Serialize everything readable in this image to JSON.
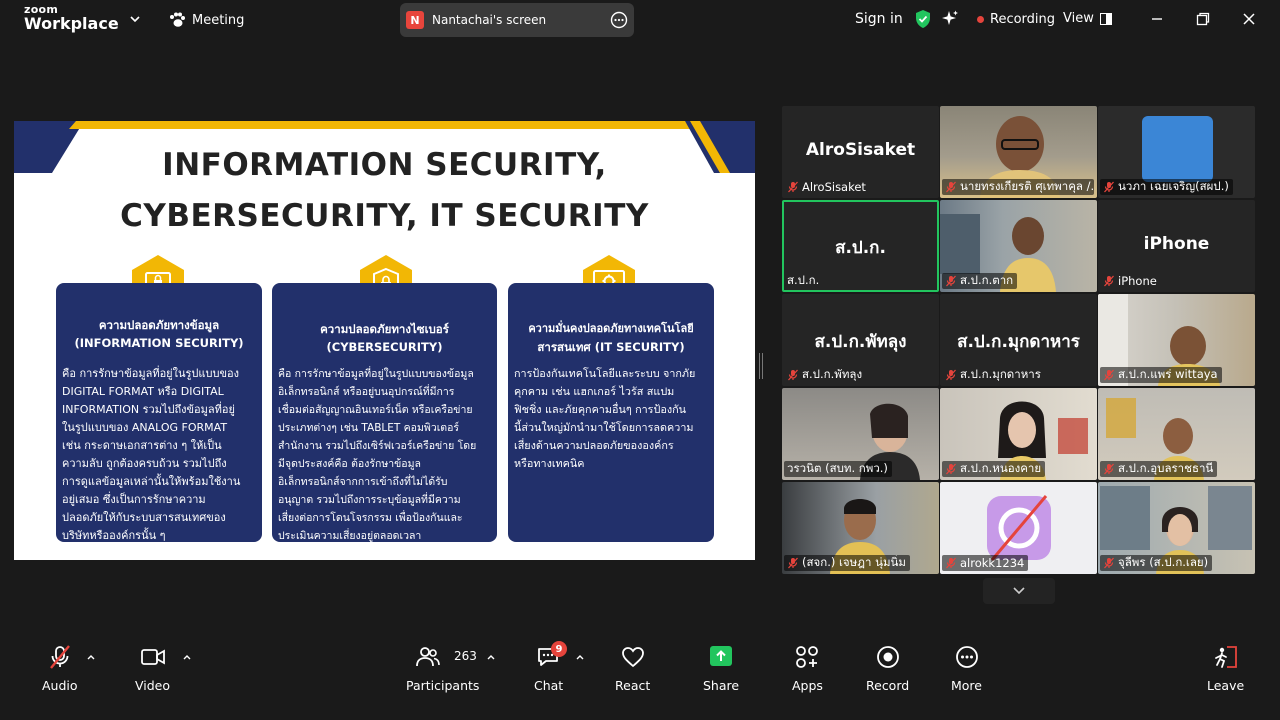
{
  "app": {
    "brand_small": "zoom",
    "brand_big": "Workplace"
  },
  "topbar": {
    "meeting_label": "Meeting",
    "share_badge": "N",
    "share_label": "Nantachai's screen",
    "signin_label": "Sign in",
    "recording_label": "Recording",
    "view_label": "View"
  },
  "slide": {
    "title_line1": "INFORMATION SECURITY,",
    "title_line2": "CYBERSECURITY, IT SECURITY",
    "cards": [
      {
        "title1": "ความปลอดภัยทางข้อมูล",
        "title2": "(INFORMATION SECURITY)",
        "lines": [
          "คือ การรักษาข้อมูลที่อยู่ในรูปแบบของ",
          "DIGITAL FORMAT หรือ DIGITAL",
          "INFORMATION รวมไปถึงข้อมูลที่อยู่",
          "ในรูปแบบของ ANALOG FORMAT",
          "เช่น กระดาษเอกสารต่าง ๆ ให้เป็น",
          "ความลับ ถูกต้องครบถ้วน  รวมไปถึง",
          "การดูแลข้อมูลเหล่านั้นให้พร้อมใช้งาน",
          "อยู่เสมอ ซึ่งเป็นการรักษาความ",
          "ปลอดภัยให้กับระบบสารสนเทศของ",
          "บริษัทหรือองค์กรนั้น ๆ"
        ]
      },
      {
        "title1": "ความปลอดภัยทางไซเบอร์",
        "title2": "(CYBERSECURITY)",
        "lines": [
          "คือ การรักษาข้อมูลที่อยู่ในรูปแบบของข้อมูล",
          "อิเล็กทรอนิกส์ หรืออยู่บนอุปกรณ์ที่มีการ",
          "เชื่อมต่อสัญญาณอินเทอร์เน็ต หรือเครือข่าย",
          "ประเภทต่างๆ เช่น TABLET คอมพิวเตอร์",
          "สำนักงาน รวมไปถึงเซิร์ฟเวอร์เครือข่าย โดย",
          "มีจุดประสงค์คือ ต้องรักษาข้อมูล",
          "อิเล็กทรอนิกส์จากการเข้าถึงที่ไม่ได้รับ",
          "อนุญาต รวมไปถึงการระบุข้อมูลที่มีความ",
          "เสี่ยงต่อการโดนโจรกรรม เพื่อป้องกันและ",
          "ประเมินความเสี่ยงอยู่ตลอดเวลา"
        ]
      },
      {
        "title1": "ความมั่นคงปลอดภัยทางเทคโนโลยี",
        "title2": "สารสนเทศ (IT SECURITY)",
        "lines": [
          "การป้องกันเทคโนโลยีและระบบ จากภัย",
          "คุกคาม เช่น แฮกเกอร์ ไวรัส สแปม",
          "ฟิชชิ่ง และภัยคุกคามอื่นๆ การป้องกัน",
          "นี้ส่วนใหญ่มักนำมาใช้โดยการลดความ",
          "เสี่ยงด้านความปลอดภัยขององค์กร",
          "หรือทางเทคนิค"
        ]
      }
    ]
  },
  "participants": [
    {
      "big": "AlroSisaket",
      "name": "AlroSisaket",
      "muted": true
    },
    {
      "big": "",
      "name": "นายทรงเกียรติ ศุเทพาคุล /...",
      "muted": true
    },
    {
      "big": "",
      "name": "นวภา เฉยเจริญ(สผป.)",
      "muted": true
    },
    {
      "big": "ส.ป.ก.",
      "name": "ส.ป.ก.",
      "muted": false
    },
    {
      "big": "",
      "name": "ส.ป.ก.ตาก",
      "muted": true
    },
    {
      "big": "iPhone",
      "name": "iPhone",
      "muted": true
    },
    {
      "big": "ส.ป.ก.พัทลุง",
      "name": "ส.ป.ก.พัทลุง",
      "muted": true
    },
    {
      "big": "ส.ป.ก.มุกดาหาร",
      "name": "ส.ป.ก.มุกดาหาร",
      "muted": true
    },
    {
      "big": "",
      "name": "ส.ป.ก.แพร่ wittaya",
      "muted": true
    },
    {
      "big": "",
      "name": "วรวนิต (สบท. กพว.)",
      "muted": false
    },
    {
      "big": "",
      "name": "ส.ป.ก.หนองคาย",
      "muted": true
    },
    {
      "big": "",
      "name": "ส.ป.ก.อุบลราชธานี",
      "muted": true
    },
    {
      "big": "",
      "name": "(สจก.) เจษฎา นุ่มนิ่ม",
      "muted": true
    },
    {
      "big": "",
      "name": "alrokk1234",
      "muted": true
    },
    {
      "big": "",
      "name": "จุลีพร (ส.ป.ก.เลย)",
      "muted": true
    }
  ],
  "toolbar": {
    "audio": "Audio",
    "video": "Video",
    "participants": "Participants",
    "participants_count": "263",
    "chat": "Chat",
    "chat_badge": "9",
    "react": "React",
    "share": "Share",
    "apps": "Apps",
    "record": "Record",
    "more": "More",
    "leave": "Leave"
  },
  "colors": {
    "accent_green": "#22c55e",
    "record_red": "#e5443c",
    "slide_navy": "#22306b",
    "slide_gold": "#f2b705"
  }
}
